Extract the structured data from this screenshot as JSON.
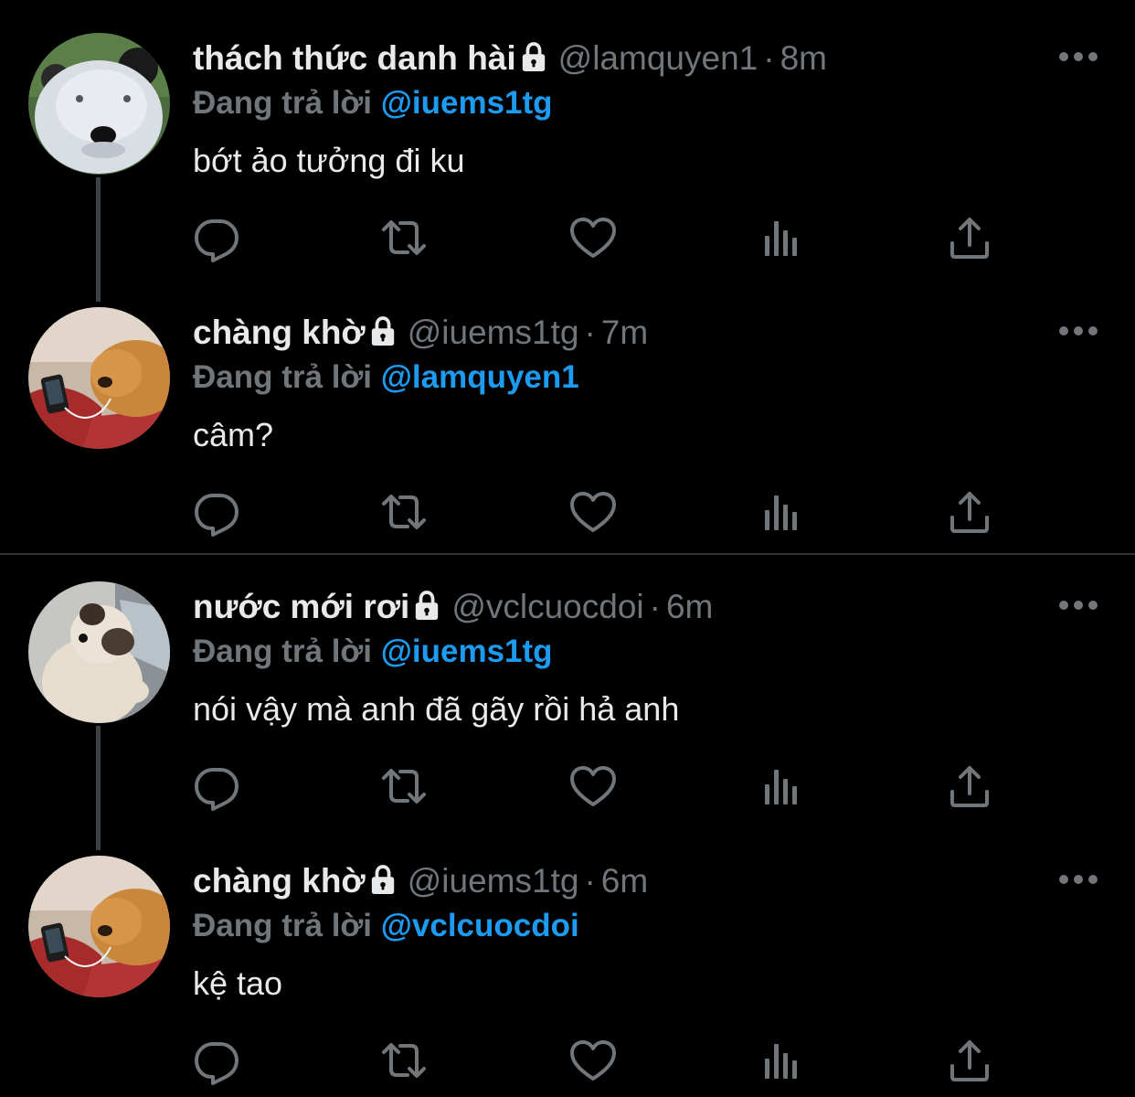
{
  "tweets": [
    {
      "name": "thách thức danh hài",
      "handle": "@lamquyen1",
      "separator": "·",
      "time": "8m",
      "reply_prefix": "Đang trả lời",
      "reply_to": "@iuems1tg",
      "text": "bớt ảo tưởng đi ku",
      "avatar": "panda-avatar"
    },
    {
      "name": "chàng khờ",
      "handle": "@iuems1tg",
      "separator": "·",
      "time": "7m",
      "reply_prefix": "Đang trả lời",
      "reply_to": "@lamquyen1",
      "text": "câm?",
      "avatar": "dog-avatar"
    },
    {
      "name": "nước mới rơi",
      "handle": "@vclcuocdoi",
      "separator": "·",
      "time": "6m",
      "reply_prefix": "Đang trả lời",
      "reply_to": "@iuems1tg",
      "text": "nói vậy mà anh đã gãy rồi hả anh",
      "avatar": "pug-avatar"
    },
    {
      "name": "chàng khờ",
      "handle": "@iuems1tg",
      "separator": "·",
      "time": "6m",
      "reply_prefix": "Đang trả lời",
      "reply_to": "@vclcuocdoi",
      "text": "kệ tao",
      "avatar": "dog-avatar"
    }
  ],
  "icons": [
    "reply-icon",
    "retweet-icon",
    "like-icon",
    "views-icon",
    "share-icon",
    "more-icon",
    "lock-icon"
  ],
  "colors": {
    "background": "#000000",
    "text": "#e7e9ea",
    "muted": "#71767b",
    "mention": "#1d9bf0",
    "thread_line": "#3e4144"
  }
}
